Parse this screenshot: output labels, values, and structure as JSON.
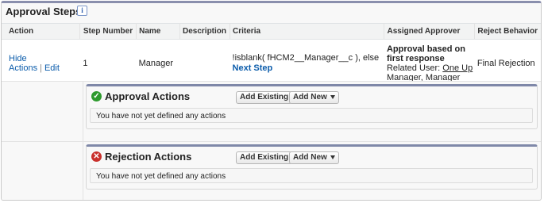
{
  "section": {
    "title": "Approval Steps",
    "info_icon": "i"
  },
  "columns": [
    "Action",
    "Step Number",
    "Name",
    "Description",
    "Criteria",
    "Assigned Approver",
    "Reject Behavior"
  ],
  "step": {
    "hide_actions": "Hide Actions",
    "separator": "|",
    "edit": "Edit",
    "step_number": "1",
    "name": "Manager",
    "description": "",
    "criteria_text": "!isblank( fHCM2__Manager__c ), else",
    "criteria_link": "Next Step",
    "approver_title": "Approval based on first response",
    "related_user_label": "Related User:",
    "related_user_name": "One Up Manager",
    "related_user_sep": ",",
    "related_user_2": "Manager",
    "reject_behavior": "Final Rejection"
  },
  "approval_actions": {
    "title": "Approval Actions",
    "add_existing": "Add Existing",
    "add_new": "Add New",
    "empty_text": "You have not yet defined any actions"
  },
  "rejection_actions": {
    "title": "Rejection Actions",
    "add_existing": "Add Existing",
    "add_new": "Add New",
    "empty_text": "You have not yet defined any actions"
  },
  "colors": {
    "header_border": "#8a8fad",
    "link": "#0b5cab",
    "ok_icon": "#2d9a2d",
    "error_icon": "#c9302c"
  }
}
